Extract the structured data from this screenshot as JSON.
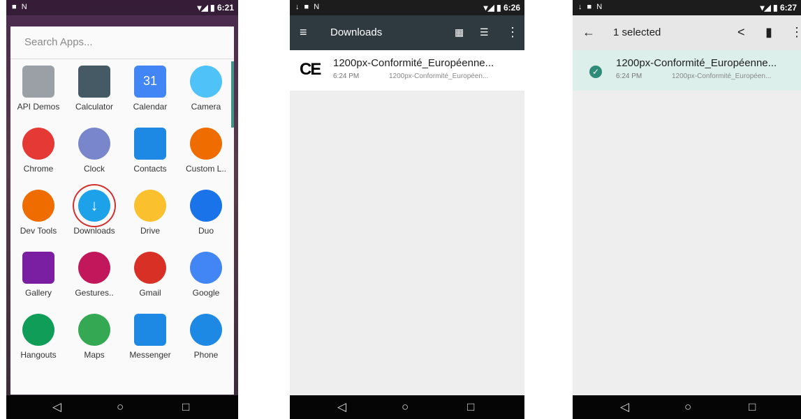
{
  "screen1": {
    "status_time": "6:21",
    "status_left": "■ N",
    "search_placeholder": "Search Apps...",
    "apps": [
      {
        "label": "API Demos",
        "icon": "folder-gear-icon",
        "color": "#9aa0a6"
      },
      {
        "label": "Calculator",
        "icon": "calculator-icon",
        "color": "#455a64"
      },
      {
        "label": "Calendar",
        "icon": "calendar-icon",
        "color": "#4285f4",
        "text": "31"
      },
      {
        "label": "Camera",
        "icon": "camera-icon",
        "color": "#4fc3f7"
      },
      {
        "label": "Chrome",
        "icon": "chrome-icon",
        "color": "#e53935"
      },
      {
        "label": "Clock",
        "icon": "clock-icon",
        "color": "#7986cb"
      },
      {
        "label": "Contacts",
        "icon": "contacts-icon",
        "color": "#1e88e5"
      },
      {
        "label": "Custom L..",
        "icon": "gear-icon",
        "color": "#ef6c00"
      },
      {
        "label": "Dev Tools",
        "icon": "dev-tools-gear-icon",
        "color": "#ef6c00"
      },
      {
        "label": "Downloads",
        "icon": "download-icon",
        "color": "#1da1e8"
      },
      {
        "label": "Drive",
        "icon": "drive-icon",
        "color": "#fbc02d"
      },
      {
        "label": "Duo",
        "icon": "duo-icon",
        "color": "#1a73e8"
      },
      {
        "label": "Gallery",
        "icon": "gallery-icon",
        "color": "#7b1fa2"
      },
      {
        "label": "Gestures..",
        "icon": "gestures-icon",
        "color": "#c2185b"
      },
      {
        "label": "Gmail",
        "icon": "gmail-icon",
        "color": "#d93025"
      },
      {
        "label": "Google",
        "icon": "google-icon",
        "color": "#4285f4"
      },
      {
        "label": "Hangouts",
        "icon": "hangouts-icon",
        "color": "#0f9d58"
      },
      {
        "label": "Maps",
        "icon": "maps-icon",
        "color": "#34a853"
      },
      {
        "label": "Messenger",
        "icon": "messenger-icon",
        "color": "#1e88e5"
      },
      {
        "label": "Phone",
        "icon": "phone-icon",
        "color": "#1e88e5"
      }
    ]
  },
  "screen2": {
    "status_time": "6:26",
    "status_left": "↓ ■ N",
    "toolbar_title": "Downloads",
    "menu_glyph": "≡",
    "grid_glyph": "▦",
    "sort_glyph": "☰",
    "more_glyph": "⋮",
    "file": {
      "ce_mark": "CE",
      "name": "1200px-Conformité_Européenne...",
      "time": "6:24 PM",
      "sub": "1200px-Conformité_Européen..."
    }
  },
  "screen3": {
    "status_time": "6:27",
    "status_left": "↓ ■ N",
    "toolbar_title": "1 selected",
    "back_glyph": "←",
    "share_glyph": "<",
    "delete_glyph": "▮",
    "more_glyph": "⋮",
    "check_glyph": "✓",
    "file": {
      "name": "1200px-Conformité_Européenne...",
      "time": "6:24 PM",
      "sub": "1200px-Conformité_Européen..."
    }
  },
  "nav": {
    "back": "◁",
    "home": "○",
    "recents": "□"
  }
}
